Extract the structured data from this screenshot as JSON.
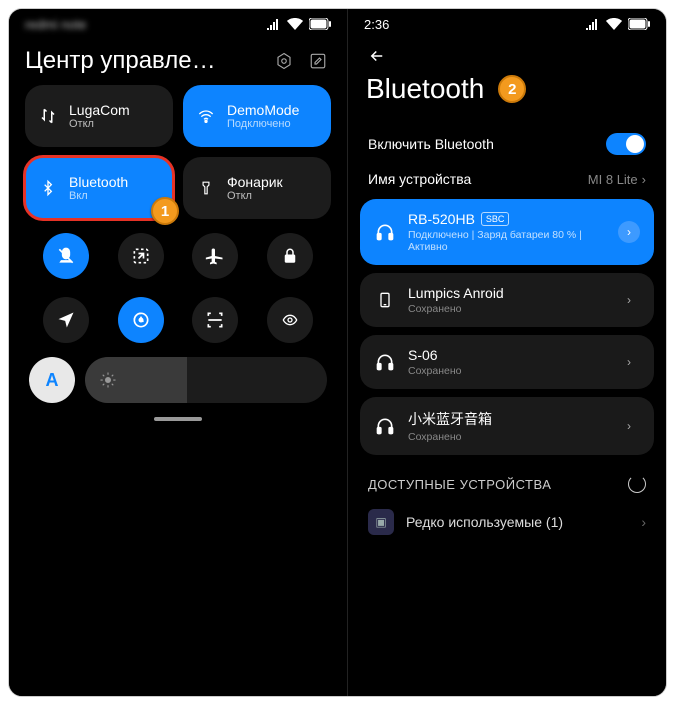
{
  "left": {
    "status_blur": "redmi note",
    "title": "Центр управле…",
    "tiles": [
      {
        "icon": "data",
        "label": "LugaCom",
        "sub": "Откл",
        "active": false,
        "highlighted": false
      },
      {
        "icon": "wifi",
        "label": "DemoMode",
        "sub": "Подключено",
        "active": true,
        "highlighted": false
      },
      {
        "icon": "bluetooth",
        "label": "Bluetooth",
        "sub": "Вкл",
        "active": true,
        "highlighted": true
      },
      {
        "icon": "flashlight",
        "label": "Фонарик",
        "sub": "Откл",
        "active": false,
        "highlighted": false
      }
    ],
    "circles_row1": [
      {
        "icon": "mute",
        "active": true
      },
      {
        "icon": "screenshot",
        "active": false
      },
      {
        "icon": "airplane",
        "active": false
      },
      {
        "icon": "lock",
        "active": false
      }
    ],
    "circles_row2": [
      {
        "icon": "location",
        "active": false
      },
      {
        "icon": "rotate",
        "active": true
      },
      {
        "icon": "scanner",
        "active": false
      },
      {
        "icon": "eye",
        "active": false
      }
    ],
    "auto_label": "A",
    "step_badge": "1"
  },
  "right": {
    "time": "2:36",
    "title": "Bluetooth",
    "step_badge": "2",
    "enable_label": "Включить Bluetooth",
    "enable_on": true,
    "name_label": "Имя устройства",
    "name_value": "MI 8 Lite",
    "devices": [
      {
        "icon": "headphones",
        "name": "RB-520HB",
        "codec": "SBC",
        "sub": "Подключено | Заряд батареи 80 % | Активно",
        "active": true
      },
      {
        "icon": "phone",
        "name": "Lumpics Anroid",
        "sub": "Сохранено",
        "active": false
      },
      {
        "icon": "headphones",
        "name": "S-06",
        "sub": "Сохранено",
        "active": false
      },
      {
        "icon": "headphones",
        "name": "小米蓝牙音箱",
        "sub": "Сохранено",
        "active": false
      }
    ],
    "available_header": "ДОСТУПНЫЕ УСТРОЙСТВА",
    "rarely_used": "Редко используемые (1)"
  }
}
